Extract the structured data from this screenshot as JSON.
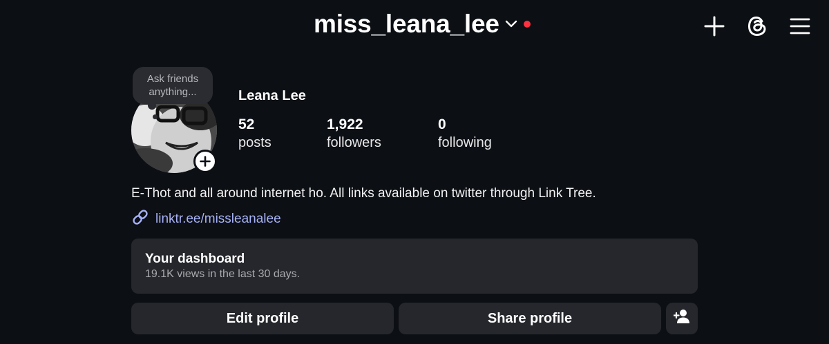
{
  "header": {
    "username": "miss_leana_lee",
    "notification_color": "#ff3040",
    "icons": [
      "plus-icon",
      "threads-icon",
      "menu-icon"
    ]
  },
  "profile": {
    "note": "Ask friends anything...",
    "display_name": "Leana Lee",
    "stats": [
      {
        "value": "52",
        "label": "posts"
      },
      {
        "value": "1,922",
        "label": "followers"
      },
      {
        "value": "0",
        "label": "following"
      }
    ],
    "bio": "E-Thot and all around internet ho. All links available on twitter through Link Tree.",
    "link": "linktr.ee/missleanalee",
    "link_color": "#a6b1f7"
  },
  "dashboard": {
    "title": "Your dashboard",
    "subtitle": "19.1K views in the last 30 days."
  },
  "actions": {
    "edit_label": "Edit profile",
    "share_label": "Share profile",
    "discover_icon": "add-person-icon"
  }
}
